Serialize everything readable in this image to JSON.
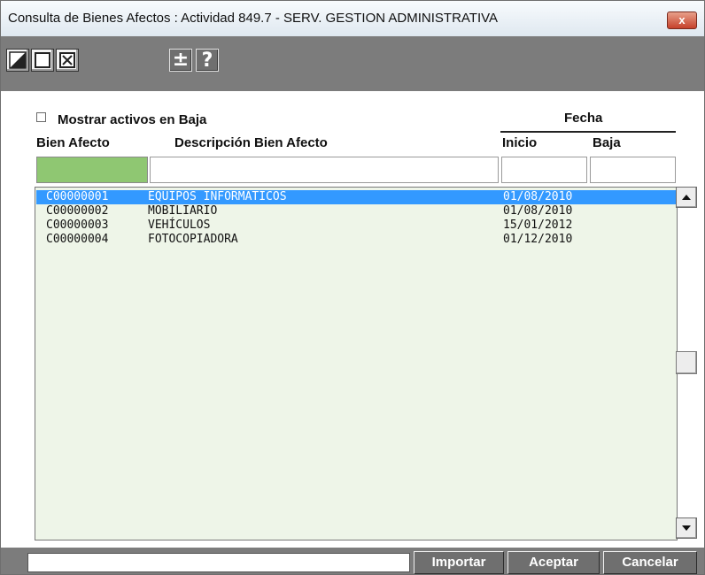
{
  "window": {
    "title": "Consulta de Bienes Afectos : Actividad 849.7 - SERV. GESTION ADMINISTRATIVA",
    "close_label": "x"
  },
  "toolbar": {
    "buttons": [
      "edit-icon",
      "blank-icon",
      "delete-icon",
      "plus-minus-icon",
      "help-icon"
    ],
    "plus_minus_label": "±",
    "help_label": "?"
  },
  "filters": {
    "show_inactive_label": "Mostrar activos en Baja",
    "show_inactive_checked": false
  },
  "table": {
    "group_header": "Fecha",
    "headers": {
      "code": "Bien Afecto",
      "description": "Descripción Bien Afecto",
      "start": "Inicio",
      "end": "Baja"
    },
    "filter_values": {
      "code": "",
      "description": "",
      "start": "",
      "end": ""
    },
    "rows": [
      {
        "code": "C00000001",
        "description": "EQUIPOS INFORMATICOS",
        "start": "01/08/2010",
        "end": ""
      },
      {
        "code": "C00000002",
        "description": "MOBILIARIO",
        "start": "01/08/2010",
        "end": ""
      },
      {
        "code": "C00000003",
        "description": "VEHÍCULOS",
        "start": "15/01/2012",
        "end": ""
      },
      {
        "code": "C00000004",
        "description": "FOTOCOPIADORA",
        "start": "01/12/2010",
        "end": ""
      }
    ],
    "selected_row": 0
  },
  "footer": {
    "status_text": "",
    "import_label": "Importar",
    "accept_label": "Aceptar",
    "cancel_label": "Cancelar"
  },
  "colors": {
    "selection": "#3399ff",
    "list_background": "#eef5e8",
    "code_filter": "#8fc772",
    "toolbar": "#7c7c7c"
  }
}
